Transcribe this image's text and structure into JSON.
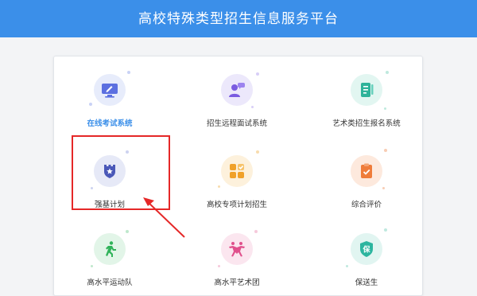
{
  "header": {
    "title": "高校特殊类型招生信息服务平台"
  },
  "tiles": [
    {
      "label": "在线考试系统",
      "icon": "computer-pen-icon",
      "color": "#5b6fe0",
      "bg": "#e7ecfb",
      "active": true
    },
    {
      "label": "招生远程面试系统",
      "icon": "interview-person-icon",
      "color": "#7a5be0",
      "bg": "#ece8fb",
      "active": false
    },
    {
      "label": "艺术类招生报名系统",
      "icon": "document-form-icon",
      "color": "#2fb39a",
      "bg": "#e2f6f1",
      "active": false
    },
    {
      "label": "强基计划",
      "icon": "shield-star-icon",
      "color": "#4a58b8",
      "bg": "#e6e9f7",
      "active": false
    },
    {
      "label": "高校专项计划招生",
      "icon": "grid-check-icon",
      "color": "#f0a12a",
      "bg": "#fdf1dc",
      "active": false
    },
    {
      "label": "综合评价",
      "icon": "clipboard-check-icon",
      "color": "#ef7c3a",
      "bg": "#fde9dd",
      "active": false
    },
    {
      "label": "高水平运动队",
      "icon": "runner-icon",
      "color": "#31b35a",
      "bg": "#e2f5e8",
      "active": false
    },
    {
      "label": "高水平艺术团",
      "icon": "dancers-icon",
      "color": "#e0508c",
      "bg": "#fbe6ef",
      "active": false
    },
    {
      "label": "保送生",
      "icon": "bao-badge-icon",
      "color": "#2cb59f",
      "bg": "#e1f5f1",
      "active": false
    }
  ],
  "annotation": {
    "color": "#e52828"
  }
}
